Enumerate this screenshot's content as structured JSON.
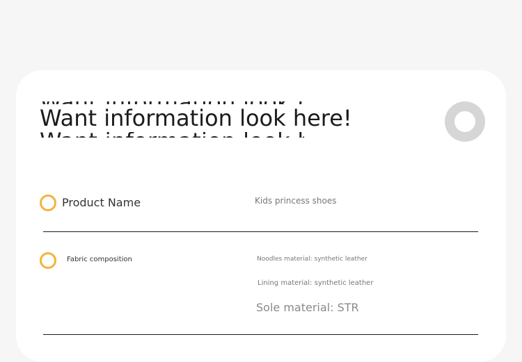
{
  "heading": {
    "title": "Want information look here!"
  },
  "rows": [
    {
      "label": "Product Name",
      "values": [
        "Kids princess shoes"
      ]
    },
    {
      "label": "Fabric composition",
      "values": [
        "Noodles material: synthetic leather",
        "Lining material: synthetic leather",
        "Sole material: STR"
      ]
    }
  ],
  "colors": {
    "accent_ring": "#f2b43a",
    "badge": "#d6d6d6",
    "divider": "#1a1a1a"
  }
}
